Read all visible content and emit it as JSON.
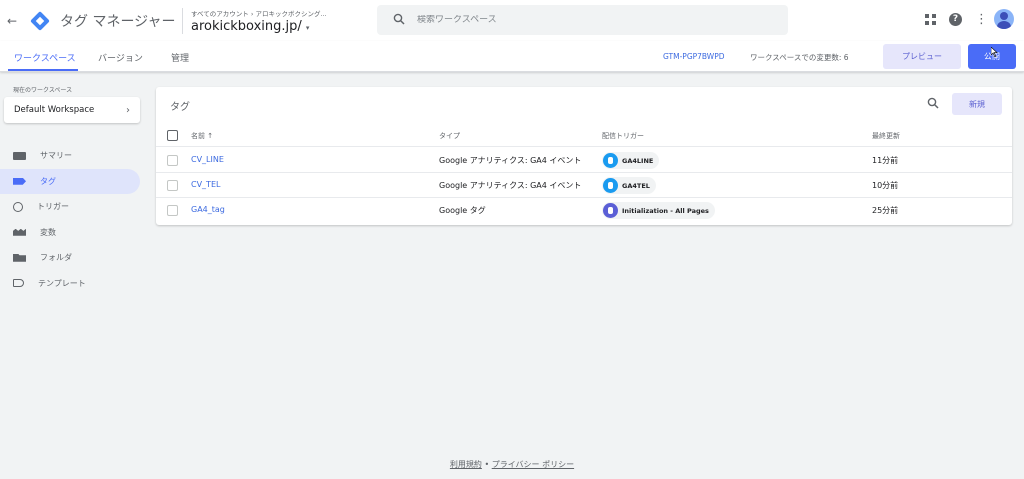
{
  "topbar": {
    "back_icon": "←",
    "product_name": "タグ マネージャー",
    "account_breadcrumb": "すべてのアカウント › アロキックボクシング...",
    "container_name": "arokickboxing.jp/",
    "container_caret": "▾",
    "search_placeholder": "検索ワークスペース"
  },
  "subnav": {
    "tabs": [
      {
        "label": "ワークスペース",
        "active": true
      },
      {
        "label": "バージョン",
        "active": false
      },
      {
        "label": "管理",
        "active": false
      }
    ],
    "container_id": "GTM-PGP7BWPD",
    "changes_text": "ワークスペースでの変更数: 6",
    "preview_label": "プレビュー",
    "publish_label": "公開"
  },
  "sidebar": {
    "workspace_label": "現在のワークスペース",
    "workspace_name": "Default Workspace",
    "items": [
      {
        "label": "サマリー",
        "icon": "summary-icon",
        "active": false
      },
      {
        "label": "タグ",
        "icon": "tag-icon",
        "active": true
      },
      {
        "label": "トリガー",
        "icon": "trigger-icon",
        "active": false
      },
      {
        "label": "変数",
        "icon": "variable-icon",
        "active": false
      },
      {
        "label": "フォルダ",
        "icon": "folder-icon",
        "active": false
      },
      {
        "label": "テンプレート",
        "icon": "template-icon",
        "active": false
      }
    ]
  },
  "tags": {
    "title": "タグ",
    "new_label": "新規",
    "columns": {
      "name": "名前 ↑",
      "type": "タイプ",
      "trigger": "配信トリガー",
      "updated": "最終更新"
    },
    "rows": [
      {
        "name": "CV_LINE",
        "type": "Google アナリティクス: GA4 イベント",
        "trigger": "GA4LINE",
        "trigger_color": "#1a9bf0",
        "updated": "11分前"
      },
      {
        "name": "CV_TEL",
        "type": "Google アナリティクス: GA4 イベント",
        "trigger": "GA4TEL",
        "trigger_color": "#1a9bf0",
        "updated": "10分前"
      },
      {
        "name": "GA4_tag",
        "type": "Google タグ",
        "trigger": "Initialization - All Pages",
        "trigger_color": "#5b5fd6",
        "updated": "25分前"
      }
    ]
  },
  "footer": {
    "terms": "利用規約",
    "separator": "•",
    "privacy": "プライバシー ポリシー"
  },
  "colors": {
    "accent": "#4a6cf7",
    "link": "#3c6ae0"
  }
}
